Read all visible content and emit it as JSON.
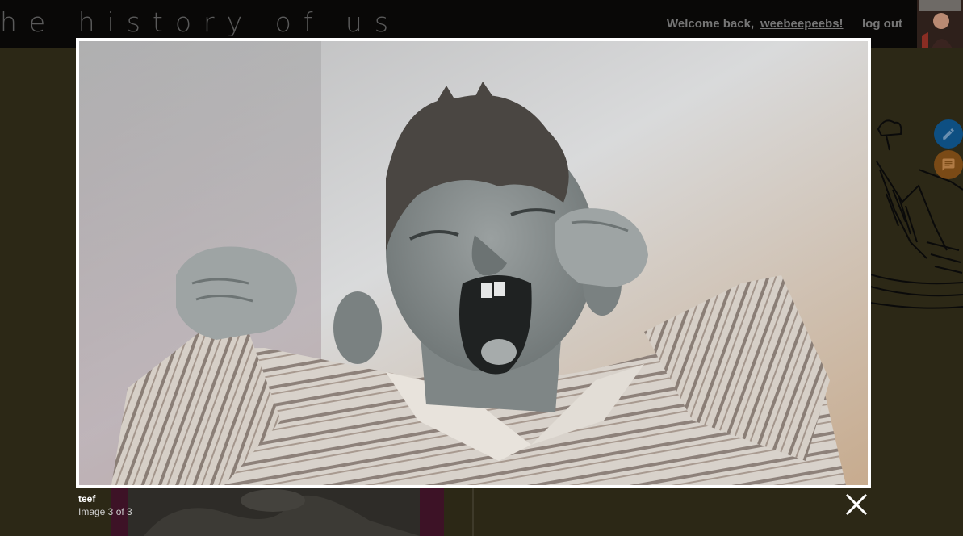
{
  "header": {
    "site_title": "the history of us",
    "welcome_text": "Welcome back,",
    "username": "weebeepeebs!",
    "logout_label": "log out",
    "avatar_icon": "user-avatar"
  },
  "side_actions": {
    "edit_icon": "pencil-icon",
    "comment_icon": "comment-icon"
  },
  "lightbox": {
    "title": "teef",
    "counter": "Image 3 of 3",
    "close_icon": "close-icon"
  },
  "colors": {
    "overlay": "#2b2818",
    "topbar": "#090807",
    "edit_fab": "#0e4f82",
    "comment_fab": "#7a4a16",
    "frame": "#ffffff"
  }
}
